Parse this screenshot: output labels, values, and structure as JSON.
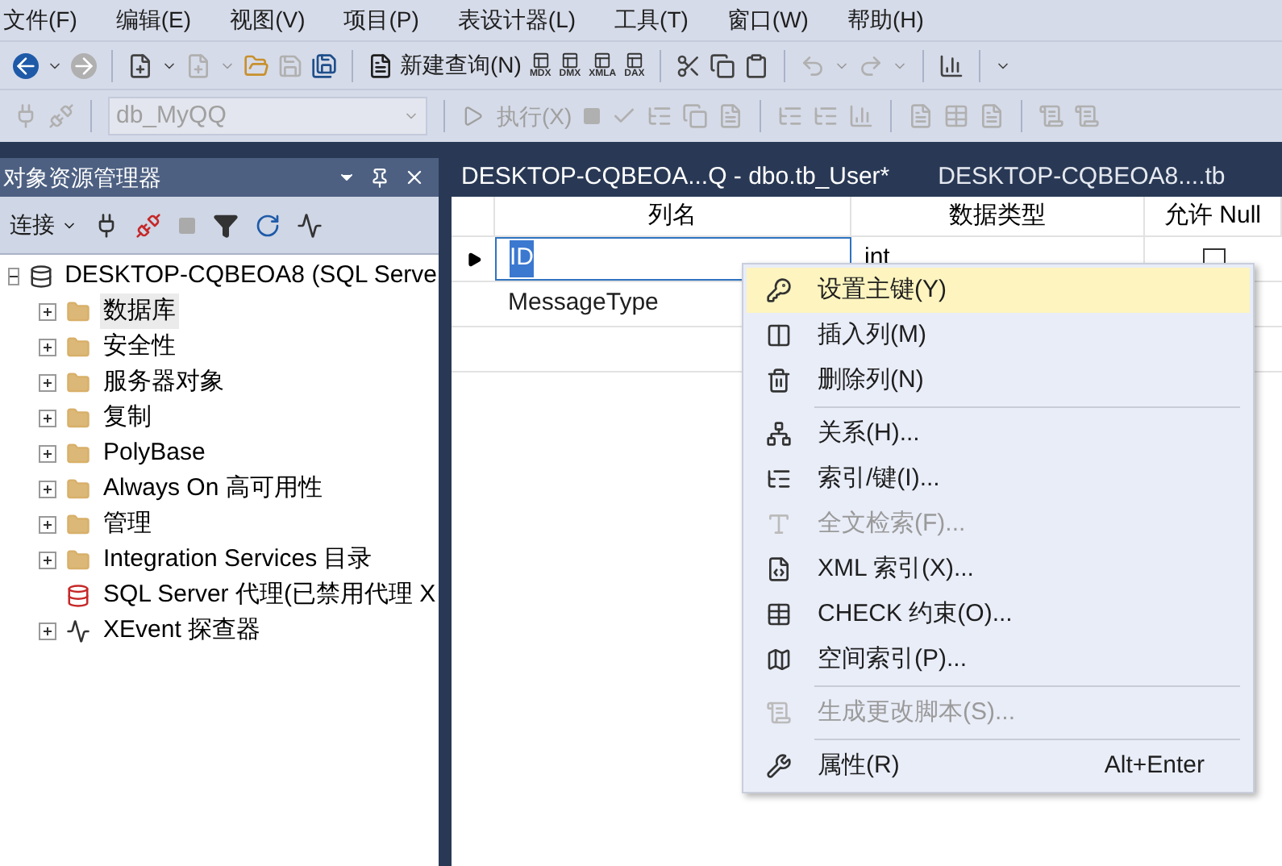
{
  "menu_bar": [
    "文件(F)",
    "编辑(E)",
    "视图(V)",
    "项目(P)",
    "表设计器(L)",
    "工具(T)",
    "窗口(W)",
    "帮助(H)"
  ],
  "toolbar": {
    "new_query": "新建查询(N)",
    "query_types": [
      "MDX",
      "DMX",
      "XMLA",
      "DAX"
    ],
    "database": {
      "value": "db_MyQQ",
      "disabled": true
    },
    "execute": {
      "label": "执行(X)",
      "disabled": true
    }
  },
  "object_explorer": {
    "title": "对象资源管理器",
    "connect": "连接",
    "tree": {
      "label": "DESKTOP-CQBEOA8 (SQL Serve",
      "kind": "server",
      "expanded": true,
      "selected": false,
      "children": [
        {
          "label": "数据库",
          "kind": "folder",
          "expandable": true,
          "selected": true
        },
        {
          "label": "安全性",
          "kind": "folder",
          "expandable": true,
          "selected": false
        },
        {
          "label": "服务器对象",
          "kind": "folder",
          "expandable": true,
          "selected": false
        },
        {
          "label": "复制",
          "kind": "folder",
          "expandable": true,
          "selected": false
        },
        {
          "label": "PolyBase",
          "kind": "folder",
          "expandable": true,
          "selected": false
        },
        {
          "label": "Always On 高可用性",
          "kind": "folder",
          "expandable": true,
          "selected": false
        },
        {
          "label": "管理",
          "kind": "folder",
          "expandable": true,
          "selected": false
        },
        {
          "label": "Integration Services 目录",
          "kind": "folder",
          "expandable": true,
          "selected": false
        },
        {
          "label": "SQL Server 代理(已禁用代理 X",
          "kind": "agent",
          "expandable": false,
          "selected": false
        },
        {
          "label": "XEvent 探查器",
          "kind": "xevent",
          "expandable": true,
          "selected": false
        }
      ]
    }
  },
  "tabs": [
    {
      "label": "DESKTOP-CQBEOA...Q - dbo.tb_User*",
      "selected": true
    },
    {
      "label": "DESKTOP-CQBEOA8....tb",
      "selected": false
    }
  ],
  "table": {
    "columns": [
      "列名",
      "数据类型",
      "允许 Null"
    ],
    "rows": [
      {
        "name": "ID",
        "type": "int",
        "allow_null": false,
        "selected": true
      },
      {
        "name": "MessageType",
        "selected": false
      },
      {
        "selected": false
      }
    ]
  },
  "context_menu": [
    {
      "kind": "item",
      "label": "设置主键(Y)",
      "selected": true,
      "disabled": false
    },
    {
      "kind": "item",
      "label": "插入列(M)",
      "selected": false,
      "disabled": false
    },
    {
      "kind": "item",
      "label": "删除列(N)",
      "selected": false,
      "disabled": false
    },
    {
      "kind": "separator"
    },
    {
      "kind": "item",
      "label": "关系(H)...",
      "selected": false,
      "disabled": false
    },
    {
      "kind": "item",
      "label": "索引/键(I)...",
      "selected": false,
      "disabled": false
    },
    {
      "kind": "item",
      "label": "全文检索(F)...",
      "selected": false,
      "disabled": true
    },
    {
      "kind": "item",
      "label": "XML 索引(X)...",
      "selected": false,
      "disabled": false
    },
    {
      "kind": "item",
      "label": "CHECK 约束(O)...",
      "selected": false,
      "disabled": false
    },
    {
      "kind": "item",
      "label": "空间索引(P)...",
      "selected": false,
      "disabled": false
    },
    {
      "kind": "separator"
    },
    {
      "kind": "item",
      "label": "生成更改脚本(S)...",
      "selected": false,
      "disabled": true
    },
    {
      "kind": "separator"
    },
    {
      "kind": "item",
      "label": "属性(R)",
      "shortcut": "Alt+Enter",
      "selected": false,
      "disabled": false
    }
  ]
}
